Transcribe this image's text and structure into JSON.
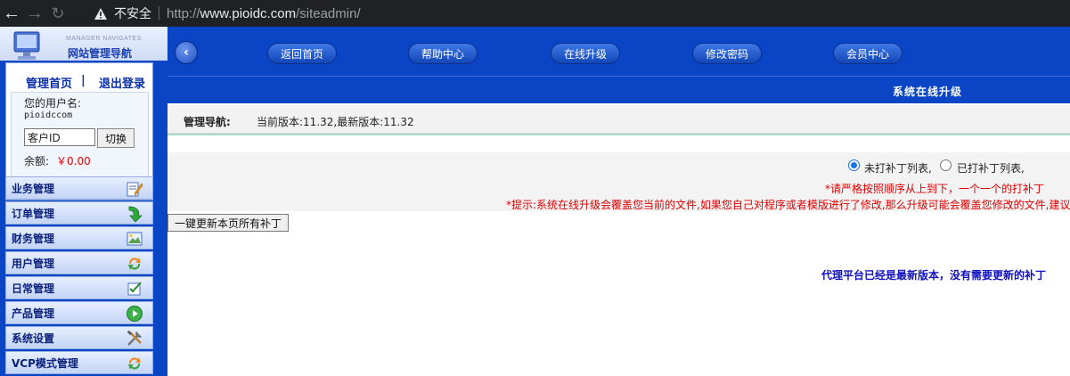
{
  "browser": {
    "back_icon": "arrow-left-icon",
    "forward_icon": "arrow-right-icon",
    "reload_icon": "reload-icon",
    "warning_icon": "warning-icon",
    "insecure_label": "不安全",
    "url_prefix": "http://",
    "url_domain": "www.pioidc.com",
    "url_path": "/siteadmin/"
  },
  "sidebar": {
    "logo_subtitle": "MANAGER NAVIGATES",
    "logo_title": "网站管理导航",
    "admin_home_link": "管理首页",
    "divider": "|",
    "logout_link": "退出登录",
    "username_label": "您的用户名:",
    "username_value": "pioidccom",
    "customer_id_value": "客户ID",
    "switch_button": "切换",
    "balance_label": "余额:",
    "balance_value": "￥0.00",
    "menu": [
      {
        "label": "业务管理",
        "icon": "pen-document-icon"
      },
      {
        "label": "订单管理",
        "icon": "green-arrow-icon"
      },
      {
        "label": "财务管理",
        "icon": "picture-icon"
      },
      {
        "label": "用户管理",
        "icon": "refresh-arrows-icon"
      },
      {
        "label": "日常管理",
        "icon": "checklist-icon"
      },
      {
        "label": "产品管理",
        "icon": "play-icon"
      },
      {
        "label": "系统设置",
        "icon": "tools-icon"
      },
      {
        "label": "VCP模式管理",
        "icon": "refresh-arrows-icon"
      }
    ]
  },
  "topnav": {
    "back_icon": "chevron-left-icon",
    "items": [
      "返回首页",
      "帮助中心",
      "在线升级",
      "修改密码",
      "会员中心"
    ]
  },
  "main": {
    "section_title": "系统在线升级",
    "breadcrumb_label": "管理导航:",
    "breadcrumb_text": "当前版本:11.32,最新版本:11.32",
    "radio_unpatched": "未打补丁列表,",
    "radio_patched": "已打补丁列表,",
    "selected_list": "未打补丁列表",
    "note_order": "*请严格按照顺序从上到下，一个一个的打补丁",
    "note_warning": "*提示:系统在线升级会覆盖您当前的文件,如果您自己对程序或者模版进行了修改,那么升级可能会覆盖您修改的文件,建议您",
    "update_all_button": "一键更新本页所有补丁",
    "status_message": "代理平台已经是最新版本，没有需要更新的补丁"
  },
  "colors": {
    "brand_blue": "#0a45c6",
    "warning_red": "#e00000",
    "status_blue": "#1010c0"
  }
}
